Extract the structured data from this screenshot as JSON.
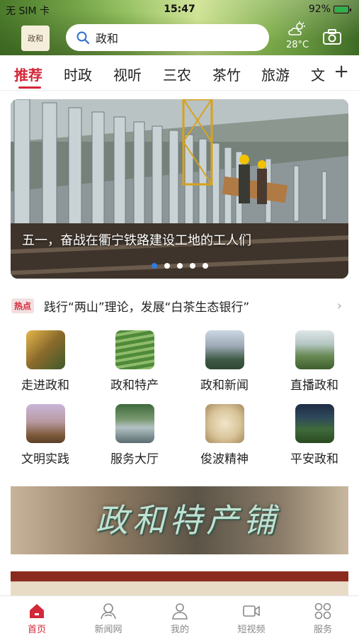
{
  "status_bar": {
    "carrier": "无 SIM 卡",
    "time": "15:47",
    "battery": "92%",
    "battery_level": 0.92
  },
  "header": {
    "logo_text": "政和",
    "search_text": "政和",
    "weather_temp": "28°C",
    "weather_icon": "partly-sunny-icon",
    "camera_icon": "camera-icon"
  },
  "tabs": [
    {
      "label": "推荐",
      "active": true
    },
    {
      "label": "时政"
    },
    {
      "label": "视听"
    },
    {
      "label": "三农"
    },
    {
      "label": "茶竹"
    },
    {
      "label": "旅游"
    },
    {
      "label": "文"
    }
  ],
  "banner": {
    "caption": "五一，奋战在衢宁铁路建设工地的工人们",
    "dots": 5,
    "active_dot": 0
  },
  "hot": {
    "badge": "热点",
    "text": "践行“两山”理论，发展“白茶生态银行”"
  },
  "grid": [
    {
      "label": "走进政和"
    },
    {
      "label": "政和特产"
    },
    {
      "label": "政和新闻"
    },
    {
      "label": "直播政和"
    },
    {
      "label": "文明实践"
    },
    {
      "label": "服务大厅"
    },
    {
      "label": "俊波精神"
    },
    {
      "label": "平安政和"
    }
  ],
  "promo": {
    "title": "政和特产铺"
  },
  "bottom_nav": [
    {
      "label": "首页",
      "icon": "home-icon",
      "active": true
    },
    {
      "label": "新闻网",
      "icon": "news-icon"
    },
    {
      "label": "我的",
      "icon": "user-icon"
    },
    {
      "label": "短视频",
      "icon": "video-icon"
    },
    {
      "label": "服务",
      "icon": "grid-icon"
    }
  ],
  "colors": {
    "accent": "#d3283a",
    "dot_active": "#2f7ce0"
  }
}
